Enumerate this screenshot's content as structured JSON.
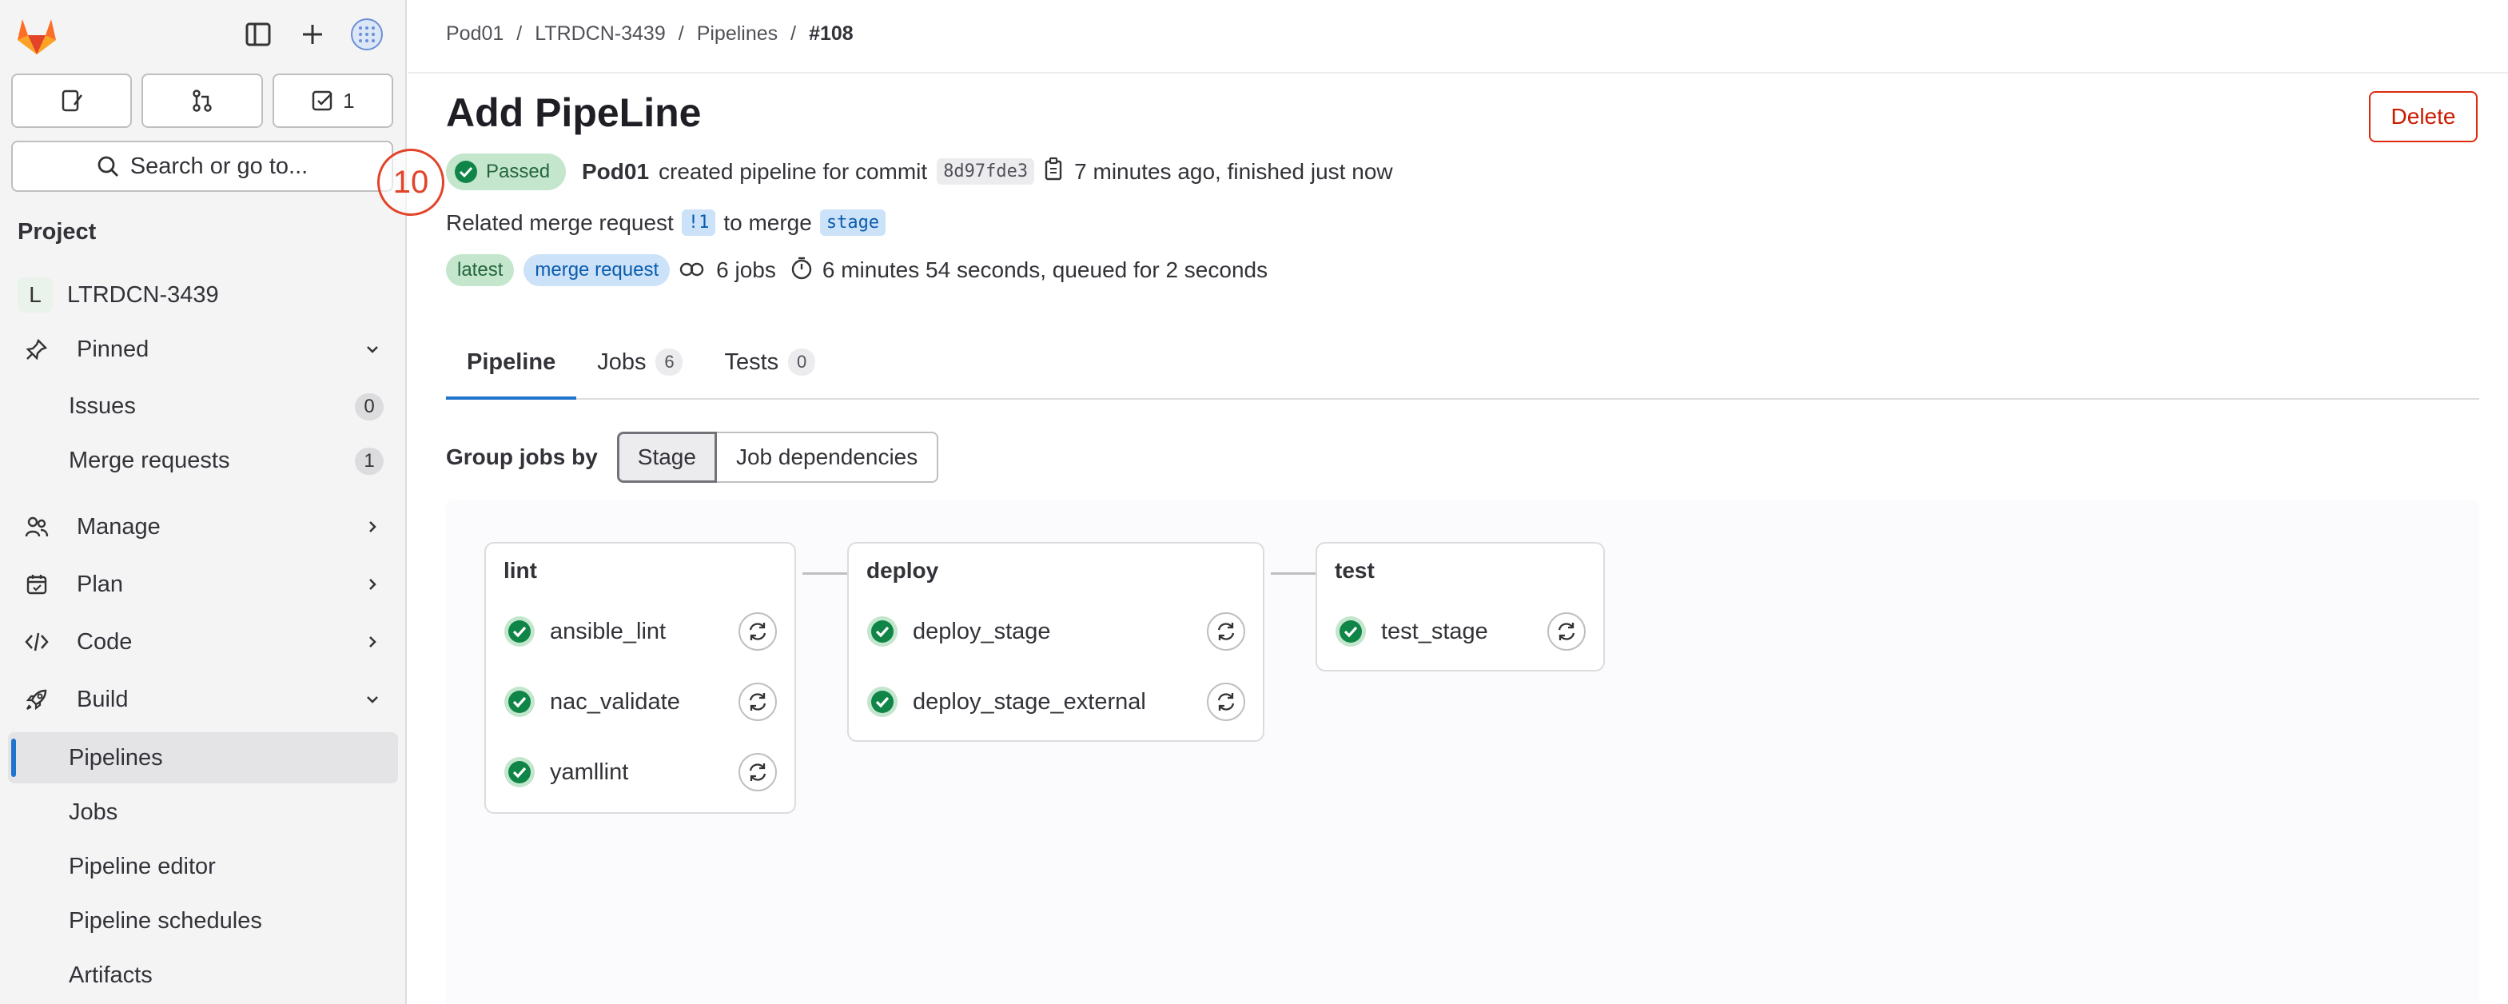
{
  "sidebar": {
    "todo_count": "1",
    "search_label": "Search or go to...",
    "section_title": "Project",
    "project": {
      "avatar_letter": "L",
      "name": "LTRDCN-3439"
    },
    "pinned": {
      "label": "Pinned",
      "items": [
        {
          "label": "Issues",
          "count": "0"
        },
        {
          "label": "Merge requests",
          "count": "1"
        }
      ]
    },
    "groups": [
      {
        "label": "Manage"
      },
      {
        "label": "Plan"
      },
      {
        "label": "Code"
      },
      {
        "label": "Build"
      }
    ],
    "build_items": [
      {
        "label": "Pipelines"
      },
      {
        "label": "Jobs"
      },
      {
        "label": "Pipeline editor"
      },
      {
        "label": "Pipeline schedules"
      },
      {
        "label": "Artifacts"
      }
    ]
  },
  "breadcrumb": [
    "Pod01",
    "LTRDCN-3439",
    "Pipelines",
    "#108"
  ],
  "page": {
    "title": "Add PipeLine",
    "delete_label": "Delete",
    "marker_number": "10",
    "status": "Passed",
    "author": "Pod01",
    "created_text": "created pipeline for commit",
    "commit_sha": "8d97fde3",
    "time_text": "7 minutes ago, finished just now",
    "related_text": "Related merge request",
    "mr_ref": "!1",
    "to_merge_text": "to merge",
    "branch": "stage",
    "labels": [
      "latest",
      "merge request"
    ],
    "jobs_count_text": "6 jobs",
    "duration_text": "6 minutes 54 seconds, queued for 2 seconds"
  },
  "tabs": [
    {
      "label": "Pipeline",
      "count": ""
    },
    {
      "label": "Jobs",
      "count": "6"
    },
    {
      "label": "Tests",
      "count": "0"
    }
  ],
  "group_by": {
    "label": "Group jobs by",
    "options": [
      "Stage",
      "Job dependencies"
    ],
    "selected": "Stage"
  },
  "stages": [
    {
      "name": "lint",
      "jobs": [
        "ansible_lint",
        "nac_validate",
        "yamllint"
      ]
    },
    {
      "name": "deploy",
      "jobs": [
        "deploy_stage",
        "deploy_stage_external"
      ]
    },
    {
      "name": "test",
      "jobs": [
        "test_stage"
      ]
    }
  ],
  "colors": {
    "success": "#108548",
    "accent": "#1f75cb",
    "danger": "#dd2b0e",
    "marker": "#e24329"
  }
}
